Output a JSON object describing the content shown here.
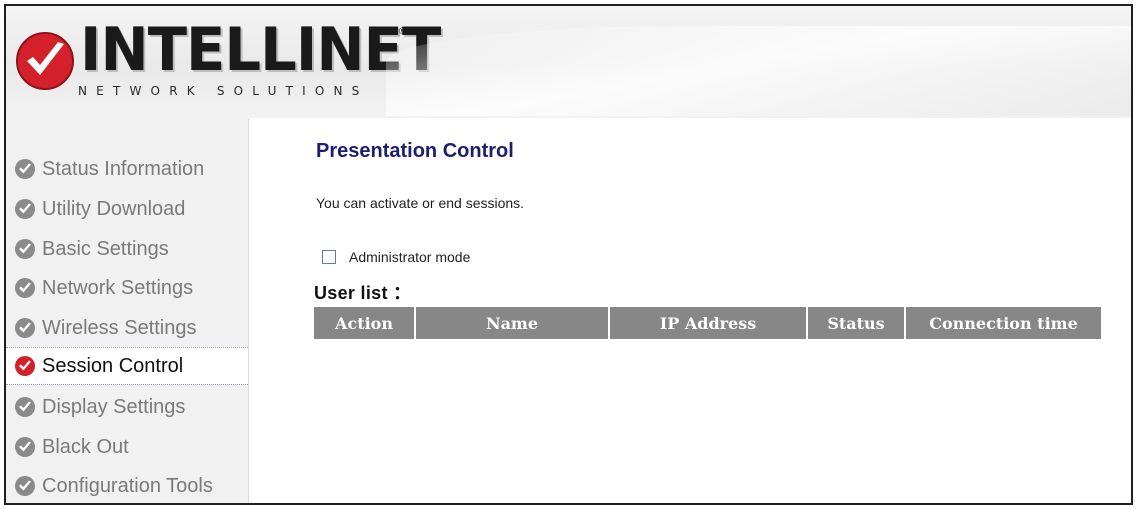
{
  "brand": {
    "name": "INTELLINET",
    "tagline": "NETWORK SOLUTIONS",
    "trademark": "®",
    "accent_color": "#d4202a"
  },
  "sidebar": {
    "items": [
      {
        "label": "Status Information",
        "icon": "check-circle-icon",
        "active": false
      },
      {
        "label": "Utility Download",
        "icon": "check-circle-icon",
        "active": false
      },
      {
        "label": "Basic Settings",
        "icon": "check-circle-icon",
        "active": false
      },
      {
        "label": "Network Settings",
        "icon": "check-circle-icon",
        "active": false
      },
      {
        "label": "Wireless Settings",
        "icon": "check-circle-icon",
        "active": false
      },
      {
        "label": "Session Control",
        "icon": "check-circle-icon",
        "active": true
      },
      {
        "label": "Display Settings",
        "icon": "check-circle-icon",
        "active": false
      },
      {
        "label": "Black Out",
        "icon": "check-circle-icon",
        "active": false
      },
      {
        "label": "Configuration Tools",
        "icon": "check-circle-icon",
        "active": false
      }
    ]
  },
  "main": {
    "title": "Presentation Control",
    "description": "You can activate or end sessions.",
    "admin_mode": {
      "label": "Administrator mode",
      "checked": false
    },
    "user_list_label": "User list ：",
    "table": {
      "columns": [
        "Action",
        "Name",
        "IP Address",
        "Status",
        "Connection time"
      ],
      "rows": []
    }
  }
}
